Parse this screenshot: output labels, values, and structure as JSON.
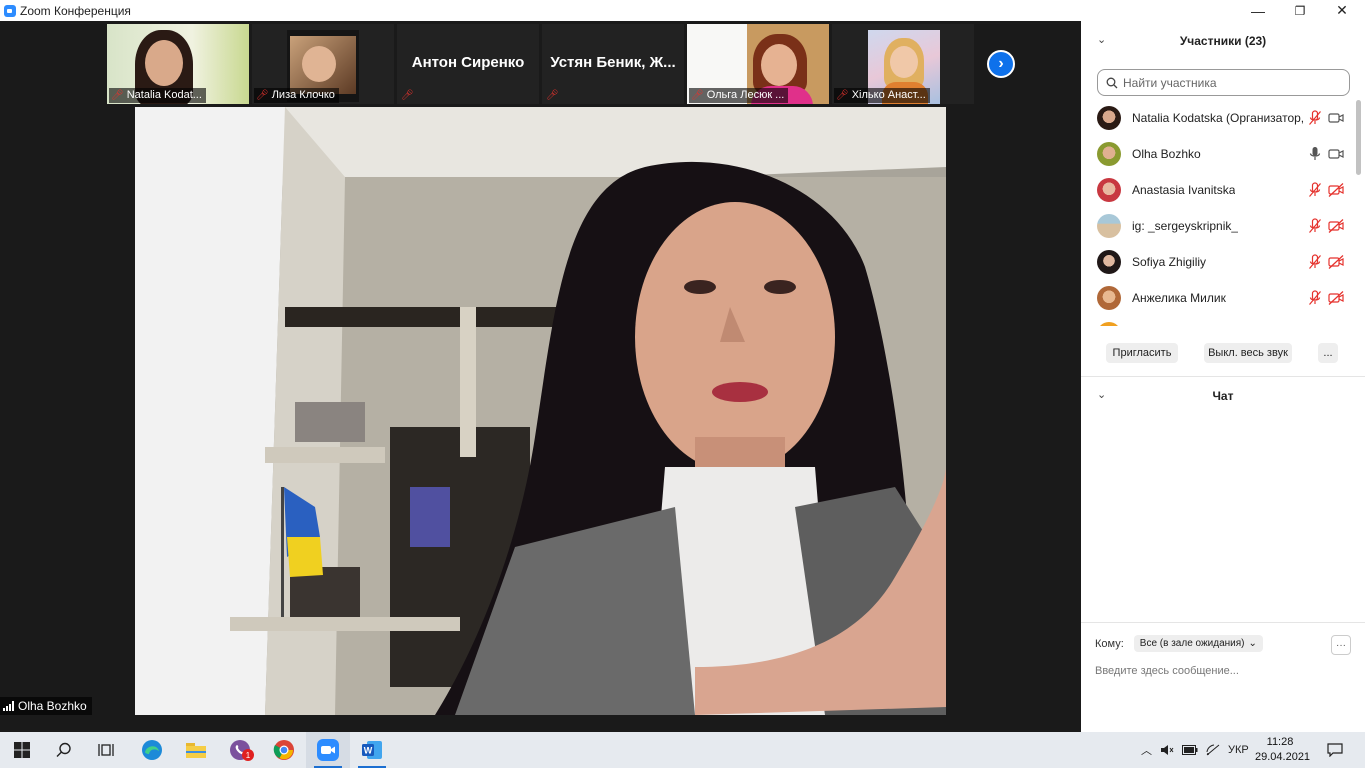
{
  "window": {
    "title": "Zoom Конференция",
    "minimize": "—",
    "maximize": "❐",
    "close": "✕"
  },
  "thumbnails": [
    {
      "name": "Natalia Kodat...",
      "type": "video"
    },
    {
      "name": "Лиза Клочко",
      "type": "video"
    },
    {
      "name": "",
      "display_name": "Антон Сиренко",
      "type": "name"
    },
    {
      "name": "",
      "display_name": "Устян Беник, Ж...",
      "type": "name"
    },
    {
      "name": "Ольга Лесюк ...",
      "type": "video"
    },
    {
      "name": "Хiлько Анаст...",
      "type": "video"
    }
  ],
  "next_button": "›",
  "speaker": {
    "name": "Olha Bozhko"
  },
  "participants_panel": {
    "header": "Участники (23)",
    "search_placeholder": "Найти участника",
    "participants": [
      {
        "name": "Natalia Kodatska (Организатор, я)",
        "mic": "muted",
        "video": "on"
      },
      {
        "name": "Olha Bozhko",
        "mic": "on",
        "video": "on"
      },
      {
        "name": "Anastasia Ivanitska",
        "mic": "muted",
        "video": "off"
      },
      {
        "name": "ig: _sergeyskripnik_",
        "mic": "muted",
        "video": "off"
      },
      {
        "name": "Sofiya Zhigiliy",
        "mic": "muted",
        "video": "off"
      },
      {
        "name": "Анжелика Милик",
        "mic": "muted",
        "video": "off"
      }
    ],
    "invite_button": "Пригласить",
    "mute_all_button": "Выкл. весь звук",
    "more_button": "..."
  },
  "chat_panel": {
    "header": "Чат",
    "to_label": "Кому:",
    "to_value": "Все (в зале ожидания)",
    "more_button": "···",
    "input_placeholder": "Введите здесь сообщение..."
  },
  "taskbar": {
    "viber_badge": "1",
    "language": "УКР",
    "time": "11:28",
    "date": "29.04.2021"
  },
  "colors": {
    "accent": "#0e71eb",
    "muted_red": "#e5322d",
    "taskbar": "#e6eaef"
  }
}
